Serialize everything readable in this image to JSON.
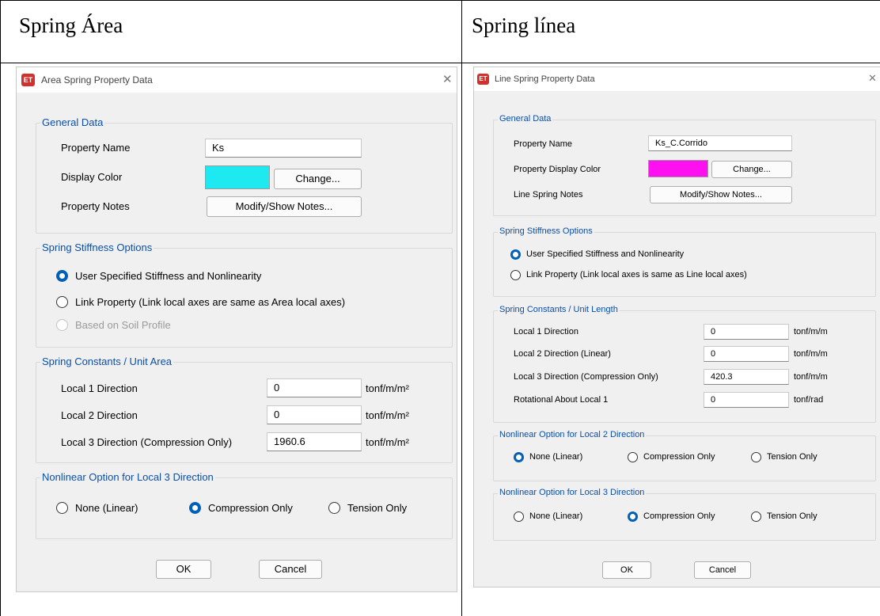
{
  "left_cell": {
    "heading": "Spring Área",
    "dialog": {
      "title": "Area Spring Property Data",
      "icon_text": "ET",
      "general": {
        "legend": "General Data",
        "property_name_label": "Property Name",
        "property_name_value": "Ks",
        "display_color_label": "Display Color",
        "display_color_value": "#1ee8f0",
        "change_button": "Change...",
        "notes_label": "Property Notes",
        "notes_button": "Modify/Show Notes..."
      },
      "stiffness": {
        "legend": "Spring Stiffness Options",
        "options": [
          "User Specified Stiffness and Nonlinearity",
          "Link Property (Link local axes are same as Area local axes)",
          "Based on Soil Profile"
        ],
        "selected": 0
      },
      "constants": {
        "legend": "Spring Constants / Unit Area",
        "rows": [
          {
            "label": "Local 1 Direction",
            "value": "0",
            "unit": "tonf/m/m²"
          },
          {
            "label": "Local 2 Direction",
            "value": "0",
            "unit": "tonf/m/m²"
          },
          {
            "label": "Local 3 Direction  (Compression Only)",
            "value": "1960.6",
            "unit": "tonf/m/m²"
          }
        ]
      },
      "nonlinear3": {
        "legend": "Nonlinear Option for Local 3 Direction",
        "options": [
          "None (Linear)",
          "Compression Only",
          "Tension Only"
        ],
        "selected": 1
      },
      "ok": "OK",
      "cancel": "Cancel"
    }
  },
  "right_cell": {
    "heading": "Spring línea",
    "dialog": {
      "title": "Line Spring Property Data",
      "icon_text": "ET",
      "general": {
        "legend": "General Data",
        "property_name_label": "Property Name",
        "property_name_value": "Ks_C.Corrido",
        "display_color_label": "Property Display Color",
        "display_color_value": "#ff10f0",
        "change_button": "Change...",
        "notes_label": "Line Spring Notes",
        "notes_button": "Modify/Show Notes..."
      },
      "stiffness": {
        "legend": "Spring Stiffness Options",
        "options": [
          "User Specified Stiffness and Nonlinearity",
          "Link Property (Link local axes is same as Line local axes)"
        ],
        "selected": 0
      },
      "constants": {
        "legend": "Spring Constants / Unit Length",
        "rows": [
          {
            "label": "Local 1 Direction",
            "value": "0",
            "unit": "tonf/m/m"
          },
          {
            "label": "Local 2 Direction  (Linear)",
            "value": "0",
            "unit": "tonf/m/m"
          },
          {
            "label": "Local 3 Direction  (Compression Only)",
            "value": "420.3",
            "unit": "tonf/m/m"
          },
          {
            "label": "Rotational About Local 1",
            "value": "0",
            "unit": "tonf/rad"
          }
        ]
      },
      "nonlinear2": {
        "legend": "Nonlinear Option for Local 2 Direction",
        "options": [
          "None (Linear)",
          "Compression Only",
          "Tension Only"
        ],
        "selected": 0
      },
      "nonlinear3": {
        "legend": "Nonlinear Option for Local 3 Direction",
        "options": [
          "None (Linear)",
          "Compression Only",
          "Tension Only"
        ],
        "selected": 1
      },
      "ok": "OK",
      "cancel": "Cancel"
    }
  }
}
